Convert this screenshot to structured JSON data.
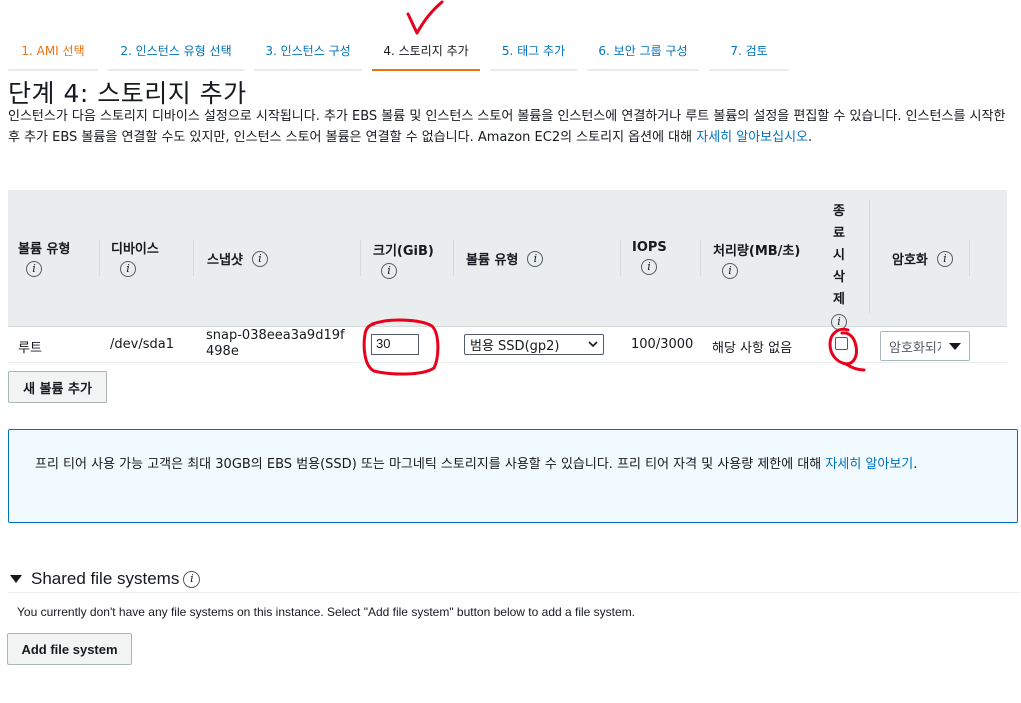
{
  "wizard_steps": [
    {
      "label": "1. AMI 선택",
      "state": "done"
    },
    {
      "label": "2. 인스턴스 유형 선택",
      "state": "todo"
    },
    {
      "label": "3. 인스턴스 구성",
      "state": "todo"
    },
    {
      "label": "4. 스토리지 추가",
      "state": "active"
    },
    {
      "label": "5. 태그 추가",
      "state": "todo"
    },
    {
      "label": "6. 보안 그룹 구성",
      "state": "todo"
    },
    {
      "label": "7. 검토",
      "state": "todo"
    }
  ],
  "page_title": "단계 4: 스토리지 추가",
  "description": {
    "text": "인스턴스가 다음 스토리지 디바이스 설정으로 시작됩니다. 추가 EBS 볼륨 및 인스턴스 스토어 볼륨을 인스턴스에 연결하거나 루트 볼륨의 설정을 편집할 수 있습니다. 인스턴스를 시작한 후 추가 EBS 볼륨을 연결할 수도 있지만, 인스턴스 스토어 볼륨은 연결할 수 없습니다. Amazon EC2의 스토리지 옵션에 대해 ",
    "link": "자세히 알아보십시오",
    "suffix": "."
  },
  "table": {
    "headers": {
      "volume_type": "볼륨 유형",
      "device": "디바이스",
      "snapshot": "스냅샷",
      "size": "크기(GiB)",
      "ebs_type": "볼륨 유형",
      "iops": "IOPS",
      "throughput": "처리량(MB/초)",
      "delete_on_term": "종료 시 삭제",
      "encryption": "암호화"
    },
    "rows": [
      {
        "volume_type": "루트",
        "device": "/dev/sda1",
        "snapshot": "snap-038eea3a9d19f498e",
        "size": "30",
        "ebs_type": "범용 SSD(gp2)",
        "iops": "100/3000",
        "throughput": "해당 사항 없음",
        "delete_on_term": false,
        "encryption": "암호화되지 않음"
      }
    ]
  },
  "add_volume_button": "새 볼륨 추가",
  "alert": {
    "text": "프리 티어 사용 가능 고객은 최대 30GB의 EBS 범용(SSD) 또는 마그네틱 스토리지를 사용할 수 있습니다. 프리 티어 자격 및 사용량 제한에 대해 ",
    "link": "자세히 알아보기",
    "suffix": "."
  },
  "shared_fs": {
    "title": "Shared file systems",
    "empty_text": "You currently don't have any file systems on this instance. Select \"Add file system\" button below to add a file system.",
    "add_button": "Add file system"
  },
  "colors": {
    "accent_orange": "#ec7211",
    "link_blue": "#0073bb",
    "annotation_red": "#e8001c"
  }
}
